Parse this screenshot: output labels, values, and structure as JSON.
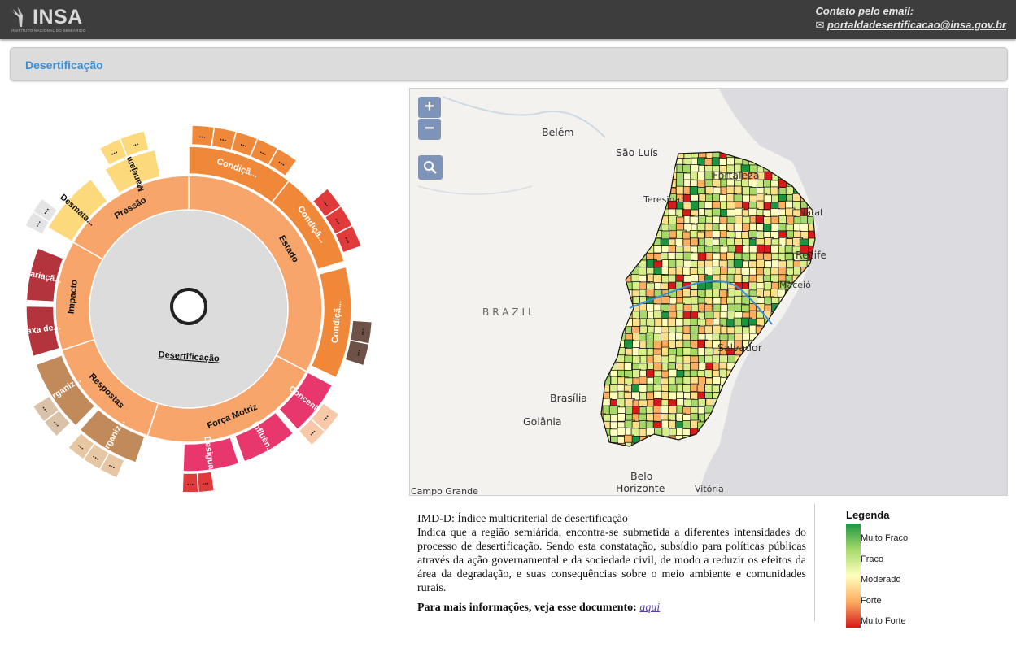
{
  "header": {
    "logo_text": "INSA",
    "logo_subtitle": "INSTITUTO NACIONAL DO SEMIÁRIDO",
    "contact_label": "Contato pelo email:",
    "contact_email": "portaldadesertificacao@insa.gov.br",
    "mail_icon": "envelope-icon"
  },
  "panel": {
    "title": "Desertificação"
  },
  "sunburst": {
    "center_label": "Desertificação",
    "colors": {
      "center": "#dcdcdc",
      "level1": "#f7a56b",
      "condicao": "#f0883a",
      "red": "#e03a3a",
      "brown": "#6e5247",
      "pink": "#e7376d",
      "tan": "#c08a5a",
      "yellow": "#fcd97a",
      "darkred": "#b3343d"
    },
    "level1": [
      "Pressão",
      "Estado",
      "Força Motriz",
      "Respostas",
      "Impacto"
    ],
    "level2": [
      "Manejam...",
      "Condiçã...",
      "Condiçã...",
      "Condiçã...",
      "Concent...",
      "Influên...",
      "Desigua...",
      "Organiz...",
      "Organiz...",
      "Taxa de...",
      "Variaçã...",
      "Desmata..."
    ],
    "more_label": "..."
  },
  "map": {
    "zoom_in": "+",
    "zoom_out": "−",
    "search_icon": "search-icon",
    "labels": {
      "belem": "Belém",
      "sao_luis": "São Luís",
      "fortaleza": "Fortaleza",
      "teresina": "Teresina",
      "natal": "Natal",
      "recife": "Recife",
      "maceio": "Maceió",
      "salvador": "Salvador",
      "brasilia": "Brasília",
      "goiania": "Goiânia",
      "belo_horizonte_1": "Belo",
      "belo_horizonte_2": "Horizonte",
      "vitoria": "Vitória",
      "campo_grande": "Campo Grande",
      "country": "BRAZIL"
    }
  },
  "description": {
    "title": "IMD-D: Índice multicriterial de desertificação",
    "body": "Indica que a região semiárida, encontra-se submetida a diferentes intensidades do processo de desertificação. Sendo esta constatação, subsídio para políticas públicas através da ação governamental e da sociedade civil, de modo a reduzir os efeitos da área da degradação, e suas consequências sobre o meio ambiente e comunidades rurais.",
    "more_label": "Para mais informações, veja esse documento:",
    "more_link": "aqui"
  },
  "legend": {
    "title": "Legenda",
    "items": [
      "Muito Fraco",
      "Fraco",
      "Moderado",
      "Forte",
      "Muito Forte"
    ]
  }
}
